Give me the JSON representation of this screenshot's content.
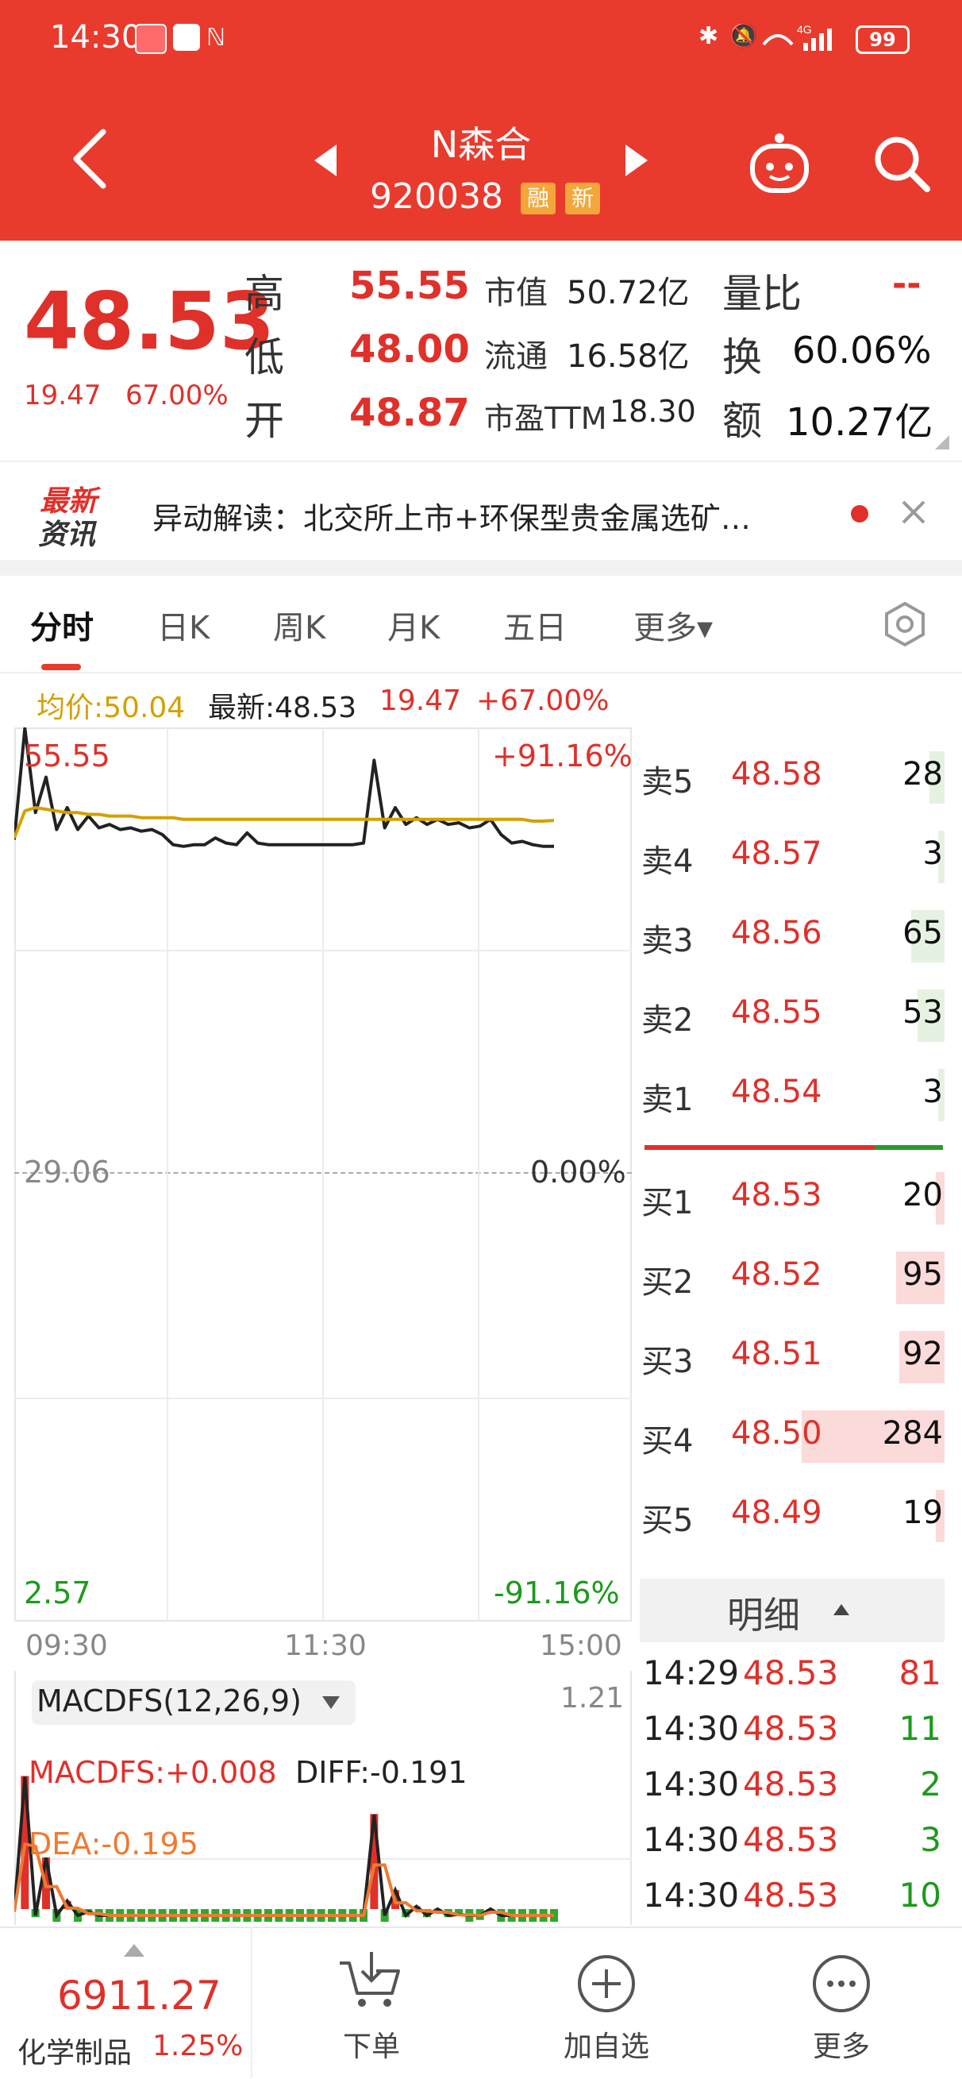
{
  "status": {
    "time": "14:30",
    "battery": "99"
  },
  "header": {
    "name": "N森合",
    "code": "920038",
    "tags": [
      "融",
      "新"
    ]
  },
  "quote": {
    "price": "48.53",
    "change": "19.47",
    "change_pct": "67.00%",
    "rows": [
      {
        "label": "高",
        "value": "55.55",
        "label2": "市值",
        "value2": "50.72亿",
        "label3": "量比",
        "value3": "--"
      },
      {
        "label": "低",
        "value": "48.00",
        "label2": "流通",
        "value2": "16.58亿",
        "label3": "换",
        "value3": "60.06%"
      },
      {
        "label": "开",
        "value": "48.87",
        "label2": "市盈TTM",
        "value2": "18.30",
        "label3": "额",
        "value3": "10.27亿"
      }
    ]
  },
  "news": {
    "logo_line1": "最新",
    "logo_line2": "资讯",
    "text": "异动解读：北交所上市+环保型贵金属选矿…"
  },
  "tabs": [
    "分时",
    "日K",
    "周K",
    "月K",
    "五日",
    "更多▾"
  ],
  "chart_info": {
    "avg": "均价:50.04",
    "latest": "最新:48.53",
    "change": "19.47",
    "change_pct": "+67.00%"
  },
  "chart_data": {
    "type": "line",
    "x": [
      "09:30",
      "11:30",
      "15:00"
    ],
    "y_left_ticks": [
      "55.55",
      "29.06",
      "2.57"
    ],
    "y_right_ticks": [
      "+91.16%",
      "0.00%",
      "-91.16%"
    ],
    "ylim": [
      2.57,
      55.55
    ],
    "series": [
      {
        "name": "",
        "values": [
          48.9,
          55.5,
          50.5,
          52.6,
          49.5,
          50.8,
          49.5,
          50.3,
          49.6,
          49.8,
          49.5,
          49.6,
          49.4,
          49.5,
          49.2,
          48.6,
          48.5,
          48.6,
          48.6,
          49.0,
          48.7,
          48.6,
          49.3,
          48.7,
          48.6,
          48.6,
          48.6,
          48.6,
          48.6,
          48.6,
          48.6,
          48.6,
          48.6,
          48.7,
          53.6,
          49.6,
          50.8,
          49.8,
          50.2,
          49.8,
          50.1,
          49.8,
          49.9,
          49.6,
          49.7,
          50.1,
          49.2,
          48.7,
          48.8,
          48.6,
          48.5,
          48.5
        ]
      },
      {
        "name": "",
        "values": [
          49.0,
          50.6,
          50.8,
          50.7,
          50.6,
          50.5,
          50.5,
          50.4,
          50.4,
          50.3,
          50.3,
          50.3,
          50.2,
          50.2,
          50.2,
          50.2,
          50.1,
          50.1,
          50.1,
          50.1,
          50.1,
          50.1,
          50.1,
          50.1,
          50.1,
          50.1,
          50.1,
          50.1,
          50.1,
          50.1,
          50.1,
          50.1,
          50.1,
          50.1,
          50.1,
          50.1,
          50.1,
          50.1,
          50.1,
          50.1,
          50.1,
          50.1,
          50.1,
          50.1,
          50.1,
          50.1,
          50.1,
          50.1,
          50.1,
          50.0,
          50.0,
          50.04
        ]
      }
    ]
  },
  "order_book": {
    "sell": [
      {
        "label": "卖5",
        "price": "48.58",
        "vol": "28",
        "frac": 0.05
      },
      {
        "label": "卖4",
        "price": "48.57",
        "vol": "3",
        "frac": 0.01
      },
      {
        "label": "卖3",
        "price": "48.56",
        "vol": "65",
        "frac": 0.11
      },
      {
        "label": "卖2",
        "price": "48.55",
        "vol": "53",
        "frac": 0.09
      },
      {
        "label": "卖1",
        "price": "48.54",
        "vol": "3",
        "frac": 0.01
      }
    ],
    "buy": [
      {
        "label": "买1",
        "price": "48.53",
        "vol": "20",
        "frac": 0.03
      },
      {
        "label": "买2",
        "price": "48.52",
        "vol": "95",
        "frac": 0.16
      },
      {
        "label": "买3",
        "price": "48.51",
        "vol": "92",
        "frac": 0.15
      },
      {
        "label": "买4",
        "price": "48.50",
        "vol": "284",
        "frac": 0.47
      },
      {
        "label": "买5",
        "price": "48.49",
        "vol": "19",
        "frac": 0.03
      }
    ],
    "sell_color": "#e6f2e1",
    "buy_color": "#fbdada"
  },
  "details": {
    "header": "明细",
    "rows": [
      {
        "time": "14:29",
        "price": "48.53",
        "vol": "81",
        "dir": "up"
      },
      {
        "time": "14:30",
        "price": "48.53",
        "vol": "11",
        "dir": "down"
      },
      {
        "time": "14:30",
        "price": "48.53",
        "vol": "2",
        "dir": "down"
      },
      {
        "time": "14:30",
        "price": "48.53",
        "vol": "3",
        "dir": "down"
      },
      {
        "time": "14:30",
        "price": "48.53",
        "vol": "10",
        "dir": "down"
      }
    ]
  },
  "macd": {
    "selector": "MACDFS(12,26,9)",
    "top_value": "1.21",
    "macdfs": "MACDFS:+0.008",
    "diff": "DIFF:-0.191",
    "dea": "DEA:-0.195"
  },
  "bottom": {
    "index_value": "6911.27",
    "index_name": "化学制品",
    "index_pct": "1.25%",
    "order": "下单",
    "watch": "加自选",
    "more": "更多"
  },
  "colors": {
    "header_red": "#e93a2e",
    "up_red": "#e0302a",
    "down_green": "#1c9a1c",
    "avg_gold": "#d4a000"
  }
}
